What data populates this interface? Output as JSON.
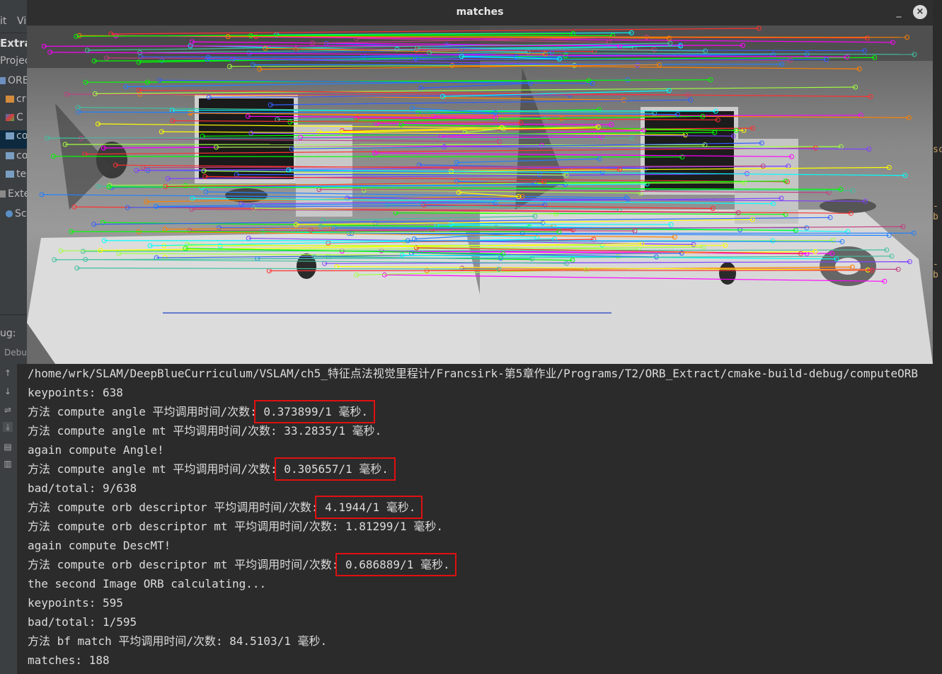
{
  "ide": {
    "menu": [
      "it",
      "Vi"
    ],
    "toolbar_title": "Extrac",
    "project_tab": "Projec",
    "tree_items": [
      {
        "label": "ORB",
        "icon": "module-icon"
      },
      {
        "label": "cr",
        "icon": "folder-icon"
      },
      {
        "label": "C",
        "icon": "cmake-icon"
      },
      {
        "label": "co",
        "icon": "target-icon"
      },
      {
        "label": "co",
        "icon": "target-icon"
      },
      {
        "label": "te",
        "icon": "target-icon"
      },
      {
        "label": "Exte",
        "icon": "library-icon"
      },
      {
        "label": "Scra",
        "icon": "scratch-icon"
      }
    ],
    "debug_label": "ug:",
    "debug_tab": "Debu",
    "right_snippets": [
      "sc",
      "-b",
      "-b"
    ]
  },
  "window": {
    "title": "matches",
    "minimize": "_",
    "close": "×"
  },
  "colors": {
    "highlight": "#e01010",
    "console_bg": "#2b2b2b",
    "console_text": "#dcdcdc"
  },
  "console": {
    "lines": [
      {
        "prefix": "/home/wrk/SLAM/DeepBlueCurriculum/VSLAM/ch5_特征点法视觉里程计/Francsirk-第5章作业/Programs/T2/ORB_Extract/cmake-build-debug/computeORB",
        "value": ""
      },
      {
        "prefix": "keypoints: 638",
        "value": ""
      },
      {
        "prefix": "方法 compute angle 平均调用时间/次数:",
        "value": " 0.373899/1 毫秒.",
        "highlight": true
      },
      {
        "prefix": "方法 compute angle mt 平均调用时间/次数: 33.2835/1 毫秒.",
        "value": ""
      },
      {
        "prefix": "again compute Angle!",
        "value": ""
      },
      {
        "prefix": "方法 compute angle mt 平均调用时间/次数:",
        "value": " 0.305657/1 毫秒.",
        "highlight": true
      },
      {
        "prefix": "bad/total: 9/638",
        "value": ""
      },
      {
        "prefix": "方法 compute orb descriptor 平均调用时间/次数:",
        "value": " 4.1944/1 毫秒.",
        "highlight": true
      },
      {
        "prefix": "方法 compute orb descriptor mt 平均调用时间/次数: 1.81299/1 毫秒.",
        "value": ""
      },
      {
        "prefix": "again compute DescMT!",
        "value": ""
      },
      {
        "prefix": "方法 compute orb descriptor mt 平均调用时间/次数:",
        "value": " 0.686889/1 毫秒.",
        "highlight": true
      },
      {
        "prefix": "the second Image ORB calculating...",
        "value": ""
      },
      {
        "prefix": "keypoints: 595",
        "value": ""
      },
      {
        "prefix": "bad/total: 1/595",
        "value": ""
      },
      {
        "prefix": "方法 bf match 平均调用时间/次数: 84.5103/1 毫秒.",
        "value": ""
      },
      {
        "prefix": "matches: 188",
        "value": ""
      }
    ]
  }
}
